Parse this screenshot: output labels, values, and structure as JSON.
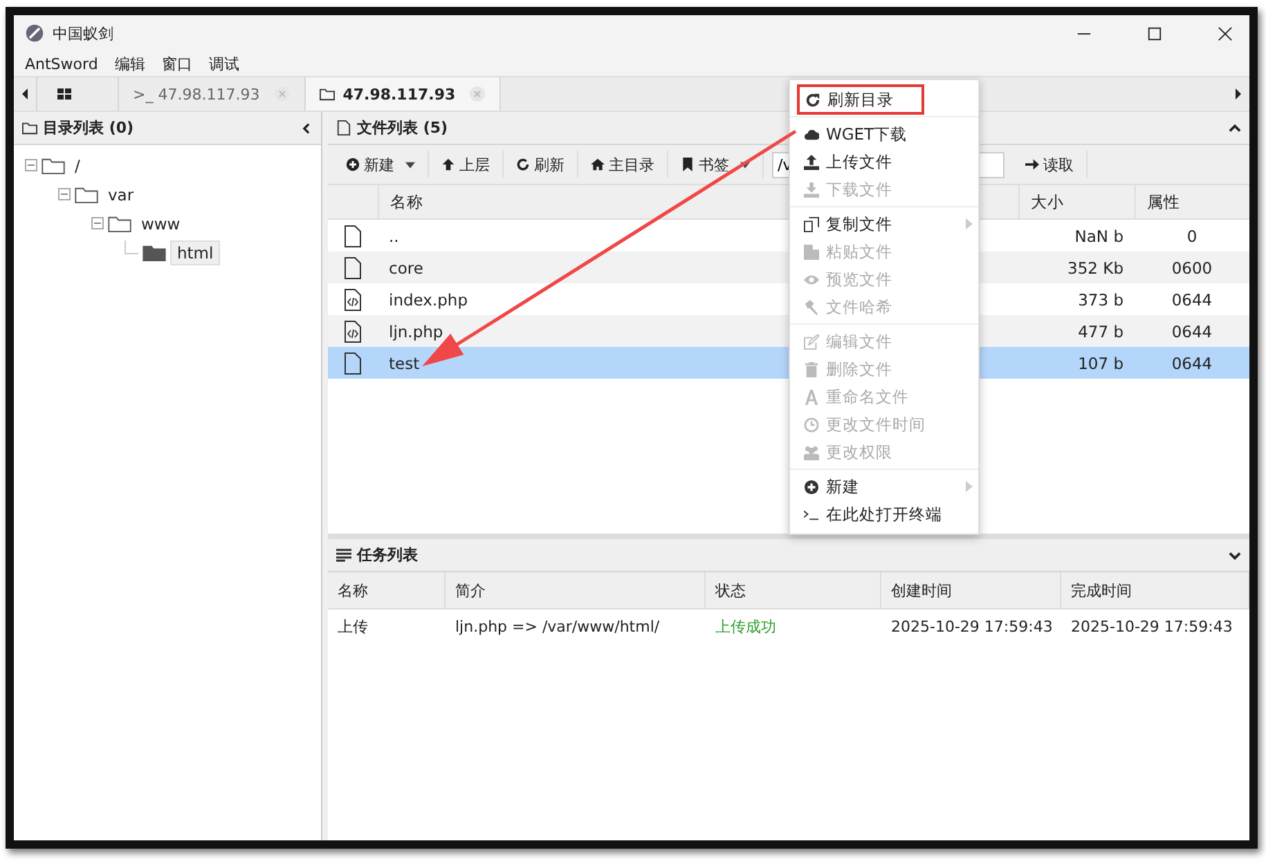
{
  "window": {
    "title": "中国蚁剑"
  },
  "menu_bar": [
    "AntSword",
    "编辑",
    "窗口",
    "调试"
  ],
  "tabs": [
    {
      "kind": "home",
      "selected": false
    },
    {
      "kind": "terminal",
      "label": ">_ 47.98.117.93",
      "selected": false
    },
    {
      "kind": "folder",
      "label": "47.98.117.93",
      "selected": true
    }
  ],
  "directory_panel": {
    "title": "目录列表 (0)",
    "tree": [
      {
        "label": "/",
        "expanded": true,
        "selected": false,
        "children": [
          {
            "label": "var",
            "expanded": true,
            "selected": false,
            "children": [
              {
                "label": "www",
                "expanded": true,
                "selected": false,
                "children": [
                  {
                    "label": "html",
                    "selected": true
                  }
                ]
              }
            ]
          }
        ]
      }
    ]
  },
  "file_panel": {
    "title": "文件列表 (5)",
    "toolbar": [
      {
        "label": "新建",
        "dropdown": true
      },
      {
        "label": "上层",
        "dropdown": false
      },
      {
        "label": "刷新",
        "dropdown": false
      },
      {
        "label": "主目录",
        "dropdown": false
      },
      {
        "label": "书签",
        "dropdown": true
      }
    ],
    "path": "/v",
    "read_button": "读取",
    "columns": [
      "名称",
      "大小",
      "属性"
    ],
    "rows": [
      {
        "kind": "file",
        "name": "..",
        "size": "NaN b",
        "attr": "0",
        "selected": false
      },
      {
        "kind": "file",
        "name": "core",
        "size": "352 Kb",
        "attr": "0600",
        "selected": false
      },
      {
        "kind": "code",
        "name": "index.php",
        "size": "373 b",
        "attr": "0644",
        "selected": false
      },
      {
        "kind": "code",
        "name": "ljn.php",
        "size": "477 b",
        "attr": "0644",
        "selected": false
      },
      {
        "kind": "file",
        "name": "test",
        "size": "107 b",
        "attr": "0644",
        "selected": true
      }
    ]
  },
  "task_panel": {
    "title": "任务列表",
    "columns": [
      "名称",
      "简介",
      "状态",
      "创建时间",
      "完成时间"
    ],
    "rows": [
      {
        "name": "上传",
        "summary": "ljn.php => /var/www/html/",
        "status": "上传成功",
        "succeeded": true,
        "created": "2025-10-29 17:59:43",
        "finished": "2025-10-29 17:59:43"
      }
    ]
  },
  "context_menu": {
    "groups": [
      [
        {
          "label": "刷新目录",
          "disabled": false,
          "submenu": false,
          "annotated": true
        }
      ],
      [
        {
          "label": "WGET下载",
          "disabled": false,
          "submenu": false,
          "annotated": false
        },
        {
          "label": "上传文件",
          "disabled": false,
          "submenu": false,
          "annotated": false
        },
        {
          "label": "下载文件",
          "disabled": true,
          "submenu": false,
          "annotated": false
        }
      ],
      [
        {
          "label": "复制文件",
          "disabled": false,
          "submenu": true,
          "annotated": false
        },
        {
          "label": "粘贴文件",
          "disabled": true,
          "submenu": false,
          "annotated": false
        },
        {
          "label": "预览文件",
          "disabled": true,
          "submenu": false,
          "annotated": false
        },
        {
          "label": "文件哈希",
          "disabled": true,
          "submenu": false,
          "annotated": false
        }
      ],
      [
        {
          "label": "编辑文件",
          "disabled": true,
          "submenu": false,
          "annotated": false
        },
        {
          "label": "删除文件",
          "disabled": true,
          "submenu": false,
          "annotated": false
        },
        {
          "label": "重命名文件",
          "disabled": true,
          "submenu": false,
          "annotated": false
        },
        {
          "label": "更改文件时间",
          "disabled": true,
          "submenu": false,
          "annotated": false
        },
        {
          "label": "更改权限",
          "disabled": true,
          "submenu": false,
          "annotated": false
        }
      ],
      [
        {
          "label": "新建",
          "disabled": false,
          "submenu": true,
          "annotated": false
        },
        {
          "label": "在此处打开终端",
          "disabled": false,
          "submenu": false,
          "annotated": false
        }
      ]
    ]
  }
}
